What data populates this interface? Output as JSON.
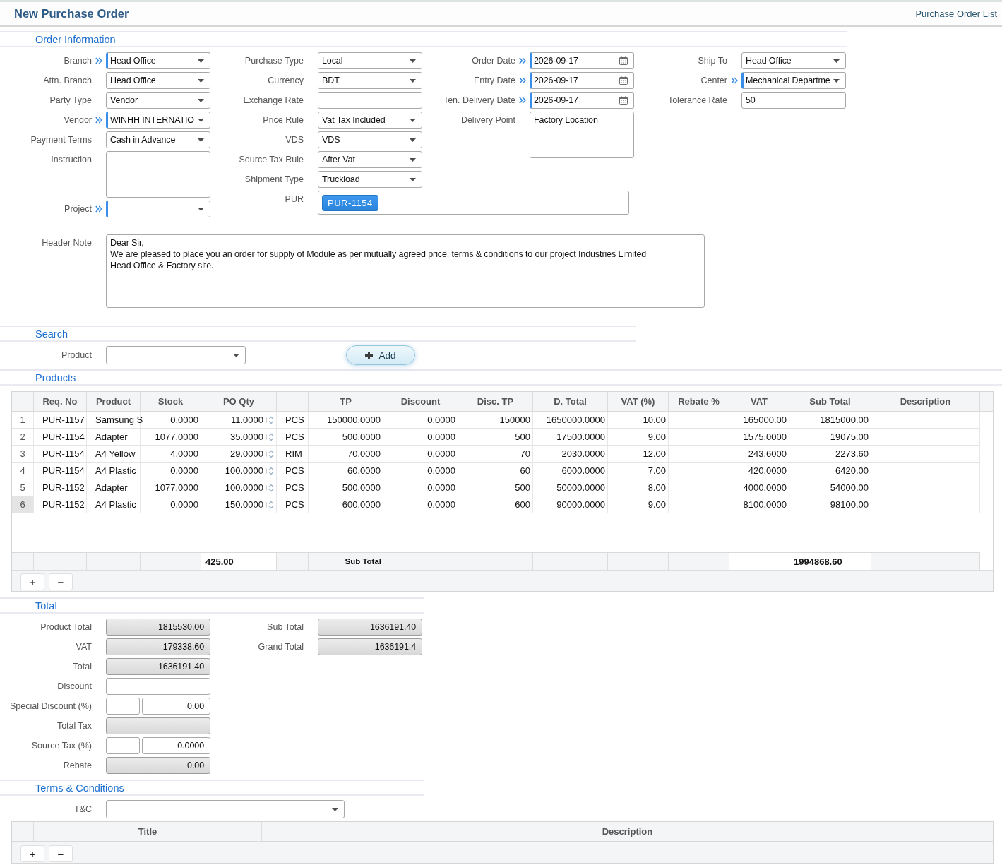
{
  "page": {
    "title": "New Purchase Order",
    "link": "Purchase Order List"
  },
  "order_information": {
    "title": "Order Information",
    "columns": [
      [
        {
          "label": "Branch",
          "kind": "select",
          "value": "Head Office",
          "required": true
        },
        {
          "label": "Attn. Branch",
          "kind": "select",
          "value": "Head Office",
          "required": false
        },
        {
          "label": "Party Type",
          "kind": "select",
          "value": "Vendor",
          "required": false
        },
        {
          "label": "Vendor",
          "kind": "select",
          "value": "WINHH INTERNATIO",
          "required": true
        },
        {
          "label": "Payment Terms",
          "kind": "select",
          "value": "Cash in Advance",
          "required": false
        },
        {
          "label": "Instruction",
          "kind": "textarea",
          "required": false
        },
        {
          "label": "Project",
          "kind": "select",
          "required": true
        }
      ],
      [
        {
          "label": "Purchase Type",
          "kind": "select",
          "value": "Local",
          "required": false
        },
        {
          "label": "Currency",
          "kind": "select",
          "value": "BDT",
          "required": false
        },
        {
          "label": "Exchange Rate",
          "kind": "text",
          "required": false
        },
        {
          "label": "Price Rule",
          "kind": "select",
          "value": "Vat Tax Included",
          "required": false
        },
        {
          "label": "VDS",
          "kind": "select",
          "value": "VDS",
          "required": false
        },
        {
          "label": "Source Tax Rule",
          "kind": "select",
          "value": "After Vat",
          "required": false
        },
        {
          "label": "Shipment Type",
          "kind": "select",
          "value": "Truckload",
          "required": false
        },
        {
          "label": "PUR",
          "kind": "tags",
          "tags": [
            "PUR-1154"
          ],
          "required": false
        }
      ],
      [
        {
          "label": "Order Date",
          "kind": "date",
          "value": "2026-09-17",
          "required": true
        },
        {
          "label": "Entry Date",
          "kind": "date",
          "value": "2026-09-17",
          "required": true
        },
        {
          "label": "Ten. Delivery Date",
          "kind": "date",
          "value": "2026-09-17",
          "required": true
        },
        {
          "label": "Delivery Point",
          "kind": "textarea",
          "value": "Factory Location",
          "required": false
        }
      ],
      [
        {
          "label": "Ship To",
          "kind": "select",
          "value": "Head Office",
          "required": false
        },
        {
          "label": "Center",
          "kind": "select",
          "value": "Mechanical Departme",
          "required": true
        },
        {
          "label": "Tolerance Rate",
          "kind": "text",
          "value": "50",
          "required": false
        }
      ]
    ]
  },
  "header_note": {
    "label": "Header Note",
    "value": "Dear Sir,\nWe are pleased to place you an order for supply of Module as per mutually agreed price, terms & conditions to our project Industries Limited\nHead Office & Factory site."
  },
  "search": {
    "title": "Search",
    "field": {
      "label": "Product"
    },
    "button": "Add"
  },
  "products": {
    "title": "Products",
    "columns": [
      {
        "label": "Req. No",
        "kind": "text"
      },
      {
        "label": "Product",
        "kind": "text"
      },
      {
        "label": "Stock",
        "kind": "number"
      },
      {
        "label": "PO Qty",
        "kind": "quantity"
      },
      {
        "kind": "text"
      },
      {
        "label": "TP",
        "kind": "number"
      },
      {
        "label": "Discount",
        "kind": "number"
      },
      {
        "label": "Disc. TP",
        "kind": "number"
      },
      {
        "label": "D. Total",
        "kind": "number"
      },
      {
        "label": "VAT (%)",
        "kind": "number"
      },
      {
        "label": "Rebate %",
        "kind": "number"
      },
      {
        "label": "VAT",
        "kind": "number"
      },
      {
        "label": "Sub Total",
        "kind": "number"
      },
      {
        "label": "Description",
        "kind": "text"
      }
    ],
    "rows": [
      {
        "number": "1",
        "selected": false,
        "cells": [
          "PUR-1157",
          "Samsung S",
          "0.0000",
          "11.0000",
          "PCS",
          "150000.0000",
          "0.0000",
          "150000",
          "1650000.0000",
          "10.00",
          null,
          "165000.00",
          "1815000.00",
          null
        ]
      },
      {
        "number": "2",
        "selected": false,
        "cells": [
          "PUR-1154",
          "Adapter",
          "1077.0000",
          "35.0000",
          "PCS",
          "500.0000",
          "0.0000",
          "500",
          "17500.0000",
          "9.00",
          null,
          "1575.0000",
          "19075.00",
          null
        ]
      },
      {
        "number": "3",
        "selected": false,
        "cells": [
          "PUR-1154",
          "A4 Yellow",
          "4.0000",
          "29.0000",
          "RIM",
          "70.0000",
          "0.0000",
          "70",
          "2030.0000",
          "12.00",
          null,
          "243.6000",
          "2273.60",
          null
        ]
      },
      {
        "number": "4",
        "selected": false,
        "cells": [
          "PUR-1154",
          "A4 Plastic",
          "0.0000",
          "100.0000",
          "PCS",
          "60.0000",
          "0.0000",
          "60",
          "6000.0000",
          "7.00",
          null,
          "420.0000",
          "6420.00",
          null
        ]
      },
      {
        "number": "5",
        "selected": false,
        "cells": [
          "PUR-1152",
          "Adapter",
          "1077.0000",
          "100.0000",
          "PCS",
          "500.0000",
          "0.0000",
          "500",
          "50000.0000",
          "8.00",
          null,
          "4000.0000",
          "54000.00",
          null
        ]
      },
      {
        "number": "6",
        "selected": true,
        "cells": [
          "PUR-1152",
          "A4 Plastic",
          "0.0000",
          "150.0000",
          "PCS",
          "600.0000",
          "0.0000",
          "600",
          "90000.0000",
          "9.00",
          null,
          "8100.0000",
          "98100.00",
          null
        ]
      }
    ],
    "footer": [
      {
        "kind": "blank"
      },
      {
        "kind": "blank"
      },
      {
        "kind": "blank"
      },
      {
        "kind": "total",
        "value": "425.00"
      },
      {
        "kind": "blank"
      },
      {
        "kind": "caption",
        "value": "Sub Total"
      },
      {
        "kind": "blank"
      },
      {
        "kind": "blank"
      },
      {
        "kind": "blank"
      },
      {
        "kind": "blank"
      },
      {
        "kind": "blank"
      },
      {
        "kind": "total"
      },
      {
        "kind": "total",
        "value": "1994868.60"
      },
      {
        "kind": "blank"
      }
    ],
    "buttons": [
      "+",
      "−"
    ]
  },
  "total": {
    "title": "Total",
    "columns": [
      [
        {
          "label": "Product Total",
          "kind": "readonly",
          "value": "1815530.00"
        },
        {
          "label": "VAT",
          "kind": "readonly",
          "value": "179338.60"
        },
        {
          "label": "Total",
          "kind": "readonly",
          "value": "1636191.40"
        },
        {
          "label": "Discount",
          "kind": "input"
        },
        {
          "label": "Special Discount (%)",
          "kind": "pair",
          "value": "0.00"
        },
        {
          "label": "Total Tax",
          "kind": "readonly"
        },
        {
          "label": "Source Tax (%)",
          "kind": "pair",
          "value": "0.0000"
        },
        {
          "label": "Rebate",
          "kind": "readonly",
          "value": "0.00"
        }
      ],
      [
        {
          "label": "Sub Total",
          "kind": "readonly",
          "value": "1636191.40"
        },
        {
          "label": "Grand Total",
          "kind": "readonly",
          "value": "1636191.4"
        }
      ]
    ]
  },
  "terms": {
    "title": "Terms & Conditions",
    "field": {
      "label": "T&C"
    },
    "columns": [
      "Title",
      "Description"
    ],
    "buttons": [
      "+",
      "−"
    ]
  }
}
